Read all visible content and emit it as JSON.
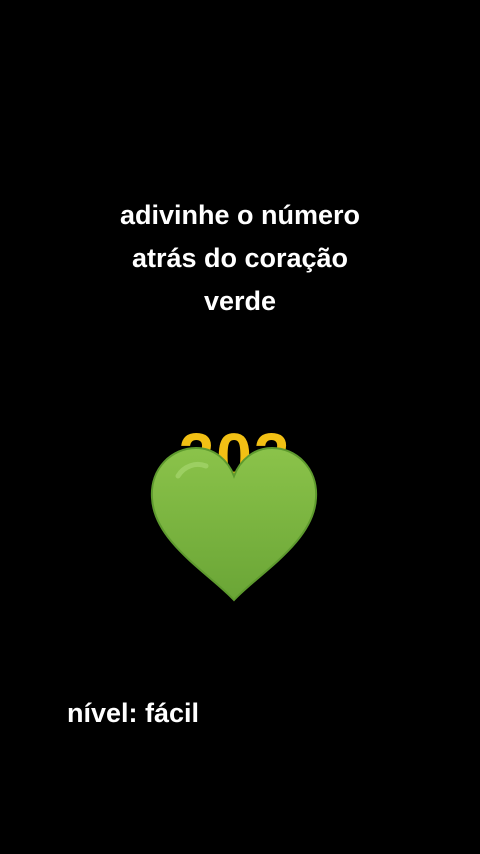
{
  "prompt": {
    "lines": [
      "adivinhe o número",
      "atrás do coração",
      "verde"
    ]
  },
  "puzzle": {
    "hidden_number": "202",
    "number_color": "#f2c014",
    "cover_icon": "green-heart-icon",
    "heart_color": "#7cb342"
  },
  "footer": {
    "level_text": "nível: fácil"
  }
}
